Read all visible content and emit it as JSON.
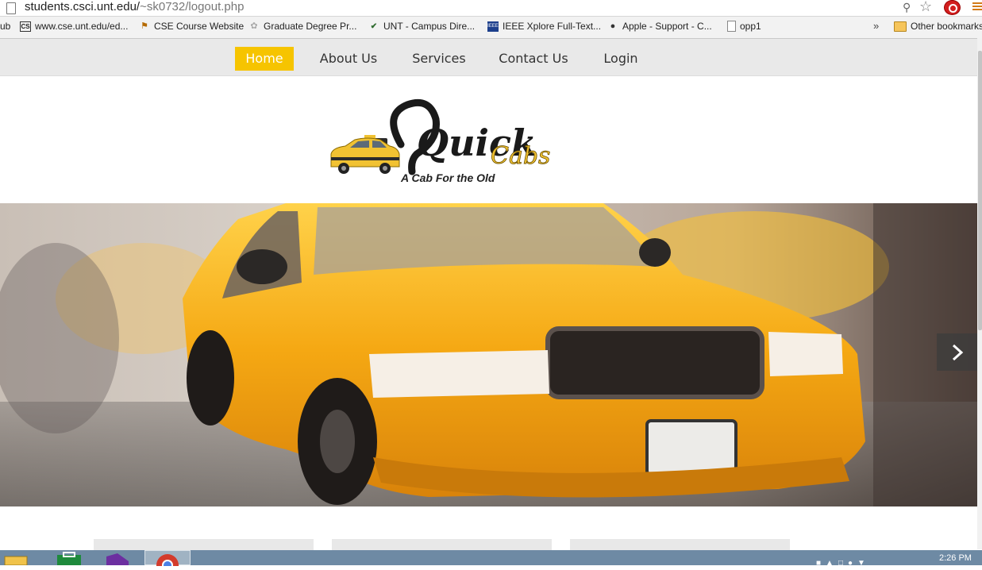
{
  "browser": {
    "url_host": "students.csci.unt.edu/",
    "url_path": "~sk0732/logout.php",
    "bookmarks": [
      {
        "label": "ub",
        "icon": "none"
      },
      {
        "label": "www.cse.unt.edu/ed...",
        "icon": "cse-favicon"
      },
      {
        "label": "CSE Course Website",
        "icon": "cse-course-favicon"
      },
      {
        "label": "Graduate Degree Pr...",
        "icon": "graduate-favicon"
      },
      {
        "label": "UNT - Campus Dire...",
        "icon": "unt-favicon"
      },
      {
        "label": "IEEE Xplore Full-Text...",
        "icon": "ieee-favicon"
      },
      {
        "label": "Apple - Support - C...",
        "icon": "apple-icon"
      },
      {
        "label": "opp1",
        "icon": "page-icon"
      }
    ],
    "more_bookmarks": "»",
    "other_bookmarks": "Other bookmarks"
  },
  "nav": {
    "items": [
      {
        "label": "Home",
        "active": true
      },
      {
        "label": "About Us",
        "active": false
      },
      {
        "label": "Services",
        "active": false
      },
      {
        "label": "Contact Us",
        "active": false
      },
      {
        "label": "Login",
        "active": false
      }
    ]
  },
  "brand": {
    "logo_text_quick": "Quick",
    "logo_text_cabs": "Cabs",
    "tagline": "A Cab For the Old",
    "accent": "#f6c400"
  },
  "hero": {
    "next_icon": "chevron-right-icon"
  },
  "taskbar": {
    "clock": "2:26 PM"
  }
}
